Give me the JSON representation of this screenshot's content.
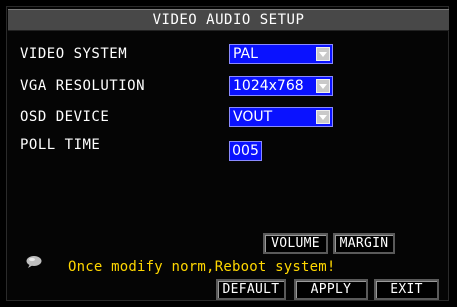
{
  "window": {
    "title": "VIDEO AUDIO SETUP"
  },
  "settings": {
    "video_system": {
      "label": "VIDEO SYSTEM",
      "value": "PAL"
    },
    "vga_resolution": {
      "label": "VGA RESOLUTION",
      "value": "1024x768"
    },
    "osd_device": {
      "label": "OSD DEVICE",
      "value": "VOUT"
    },
    "poll_time": {
      "label": "POLL TIME",
      "value": "005"
    }
  },
  "buttons": {
    "volume": "VOLUME",
    "margin": "MARGIN",
    "default": "DEFAULT",
    "apply": "APPLY",
    "exit": "EXIT"
  },
  "hint": {
    "text": "Once modify norm,Reboot system!",
    "icon": "speech-bubble-icon"
  },
  "colors": {
    "field_bg": "#0a12ff",
    "hint_text": "#ffd700",
    "title_bg": "#484848"
  }
}
